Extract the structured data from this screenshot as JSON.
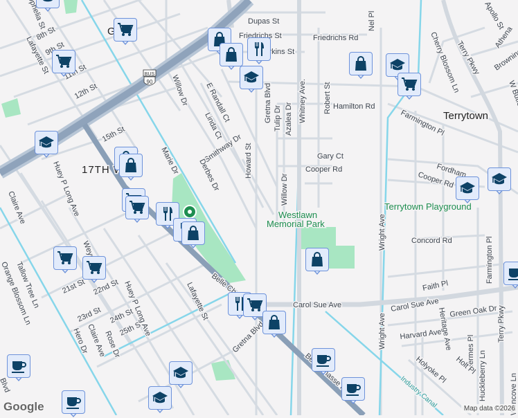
{
  "map": {
    "places": {
      "terrytown": "Terrytown",
      "seventeenth_ward": "17TH W",
      "gretna": "G",
      "westlawn_1": "Westlawn",
      "westlawn_2": "Memorial Park",
      "playground": "Terrytown Playground",
      "canal": "Industry Canal"
    },
    "streets": [
      "Dupas St",
      "Friedrichs St",
      "Friedrichs Rd",
      "Nel Pl",
      "Perkins St",
      "8th St",
      "9th St",
      "Lafayette St",
      "11th St",
      "12th St",
      "15th St",
      "Willow Dr",
      "E Randall Ct",
      "Linda Ct",
      "Smithway Dr",
      "Howard St",
      "Marie Dr",
      "Derbes Dr",
      "Gretna Blvd",
      "Tulip Dr",
      "Azalea Dr",
      "Whitney Ave.",
      "Robert St",
      "Hamilton Rd",
      "Gary Ct",
      "Cooper Rd",
      "Willow Dr",
      "Farmington Pl",
      "Cherry Blossom Ln",
      "Terry Pkwy",
      "Apollo St",
      "Athena",
      "Browning",
      "W Butler",
      "Fordham",
      "Cooper Rd",
      "Huey P Long Ave",
      "Claire Ave",
      "Wright Ave",
      "Concord Rd",
      "Faith Pl",
      "Farmington Pl",
      "Carol Sue Ave",
      "Carol Sue Ave",
      "Green Oak Dr",
      "Harvard Ave",
      "Heritage Ave",
      "Hermes Pl",
      "Holt Pl",
      "Holyoke Pl",
      "Huckleberry Ln",
      "Terry Pkwy",
      "Wencove Ln",
      "Belle Chasse",
      "Belle Chasse Hwy",
      "Lafayette St",
      "Gretna Blvd",
      "21st St",
      "22nd St",
      "23rd St",
      "24th St",
      "25th St",
      "Huey P Long Ave",
      "Hero Dr",
      "Claire Ave",
      "Rose Dr",
      "Tallow Tree Ln",
      "Orange Blossom Ln",
      "Weyer St",
      "Ophelia St",
      "Blvd",
      "Wright Ave"
    ],
    "shield": {
      "top": "BUS",
      "number": "90"
    },
    "colors": {
      "highway": "#8fa3bb",
      "canal": "#86d6ea",
      "park": "#a8e6c2",
      "marker_fill": "#e2ebfb",
      "marker_border": "#6d92da",
      "icon": "#0d4266"
    }
  },
  "markers": [
    "shopping-cart",
    "shopping-cart",
    "shopping-bag",
    "shopping-bag",
    "restaurant",
    "school",
    "school",
    "shopping-bag",
    "shopping-bag",
    "shopping-cart",
    "shopping-cart",
    "restaurant",
    "restaurant",
    "shopping-bag",
    "shopping-cart",
    "shopping-cart",
    "shopping-bag",
    "restaurant",
    "shopping-cart",
    "shopping-bag",
    "cafe",
    "cafe",
    "cafe",
    "cafe",
    "cafe",
    "school",
    "school",
    "school",
    "school",
    "shopping-bag",
    "school",
    "shopping-cart",
    "school"
  ],
  "footer": {
    "logo": "Google",
    "attribution": "Map data ©2026"
  }
}
